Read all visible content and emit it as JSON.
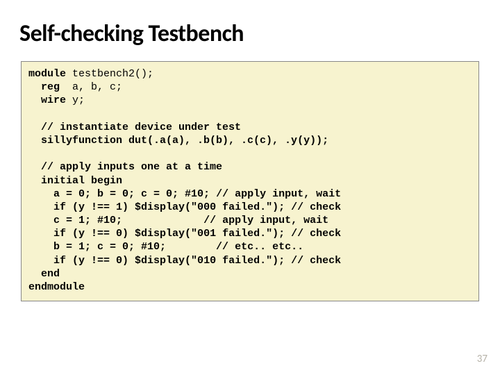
{
  "title": "Self-checking Testbench",
  "code": {
    "l1a": "module",
    "l1b": " testbench2();",
    "l2a": "  reg ",
    "l2b": " a, b, c;",
    "l3a": "  wire",
    "l3b": " y;",
    "l4": "",
    "l5a": "  // instantiate device under test",
    "l6a": "  sillyfunction dut(.a(a), .b(b), .c(c), .y(y));",
    "l7": "",
    "l8a": "  // apply inputs one at a time",
    "l9a": "  initial begin",
    "l10a": "    a = 0; b = 0; c = 0; ",
    "l10b": "#10;",
    "l10c": " // apply input, wait",
    "l11a": "    if",
    "l11b": " (y !== 1) ",
    "l11c": "$display(\"000 failed.\");",
    "l11d": " // check",
    "l12a": "    c = 1; ",
    "l12b": "#10;",
    "l12c": "             // apply input, wait",
    "l13a": "    if",
    "l13b": " (y !== 0) ",
    "l13c": "$display(\"001 failed.\");",
    "l13d": " // check",
    "l14a": "    b = 1; c = 0; ",
    "l14b": "#10;",
    "l14c": "        // etc.. etc..",
    "l15a": "    if",
    "l15b": " (y !== 0) ",
    "l15c": "$display(\"010 failed.\");",
    "l15d": " // check",
    "l16a": "  end",
    "l17a": "endmodule"
  },
  "page_number": "37"
}
